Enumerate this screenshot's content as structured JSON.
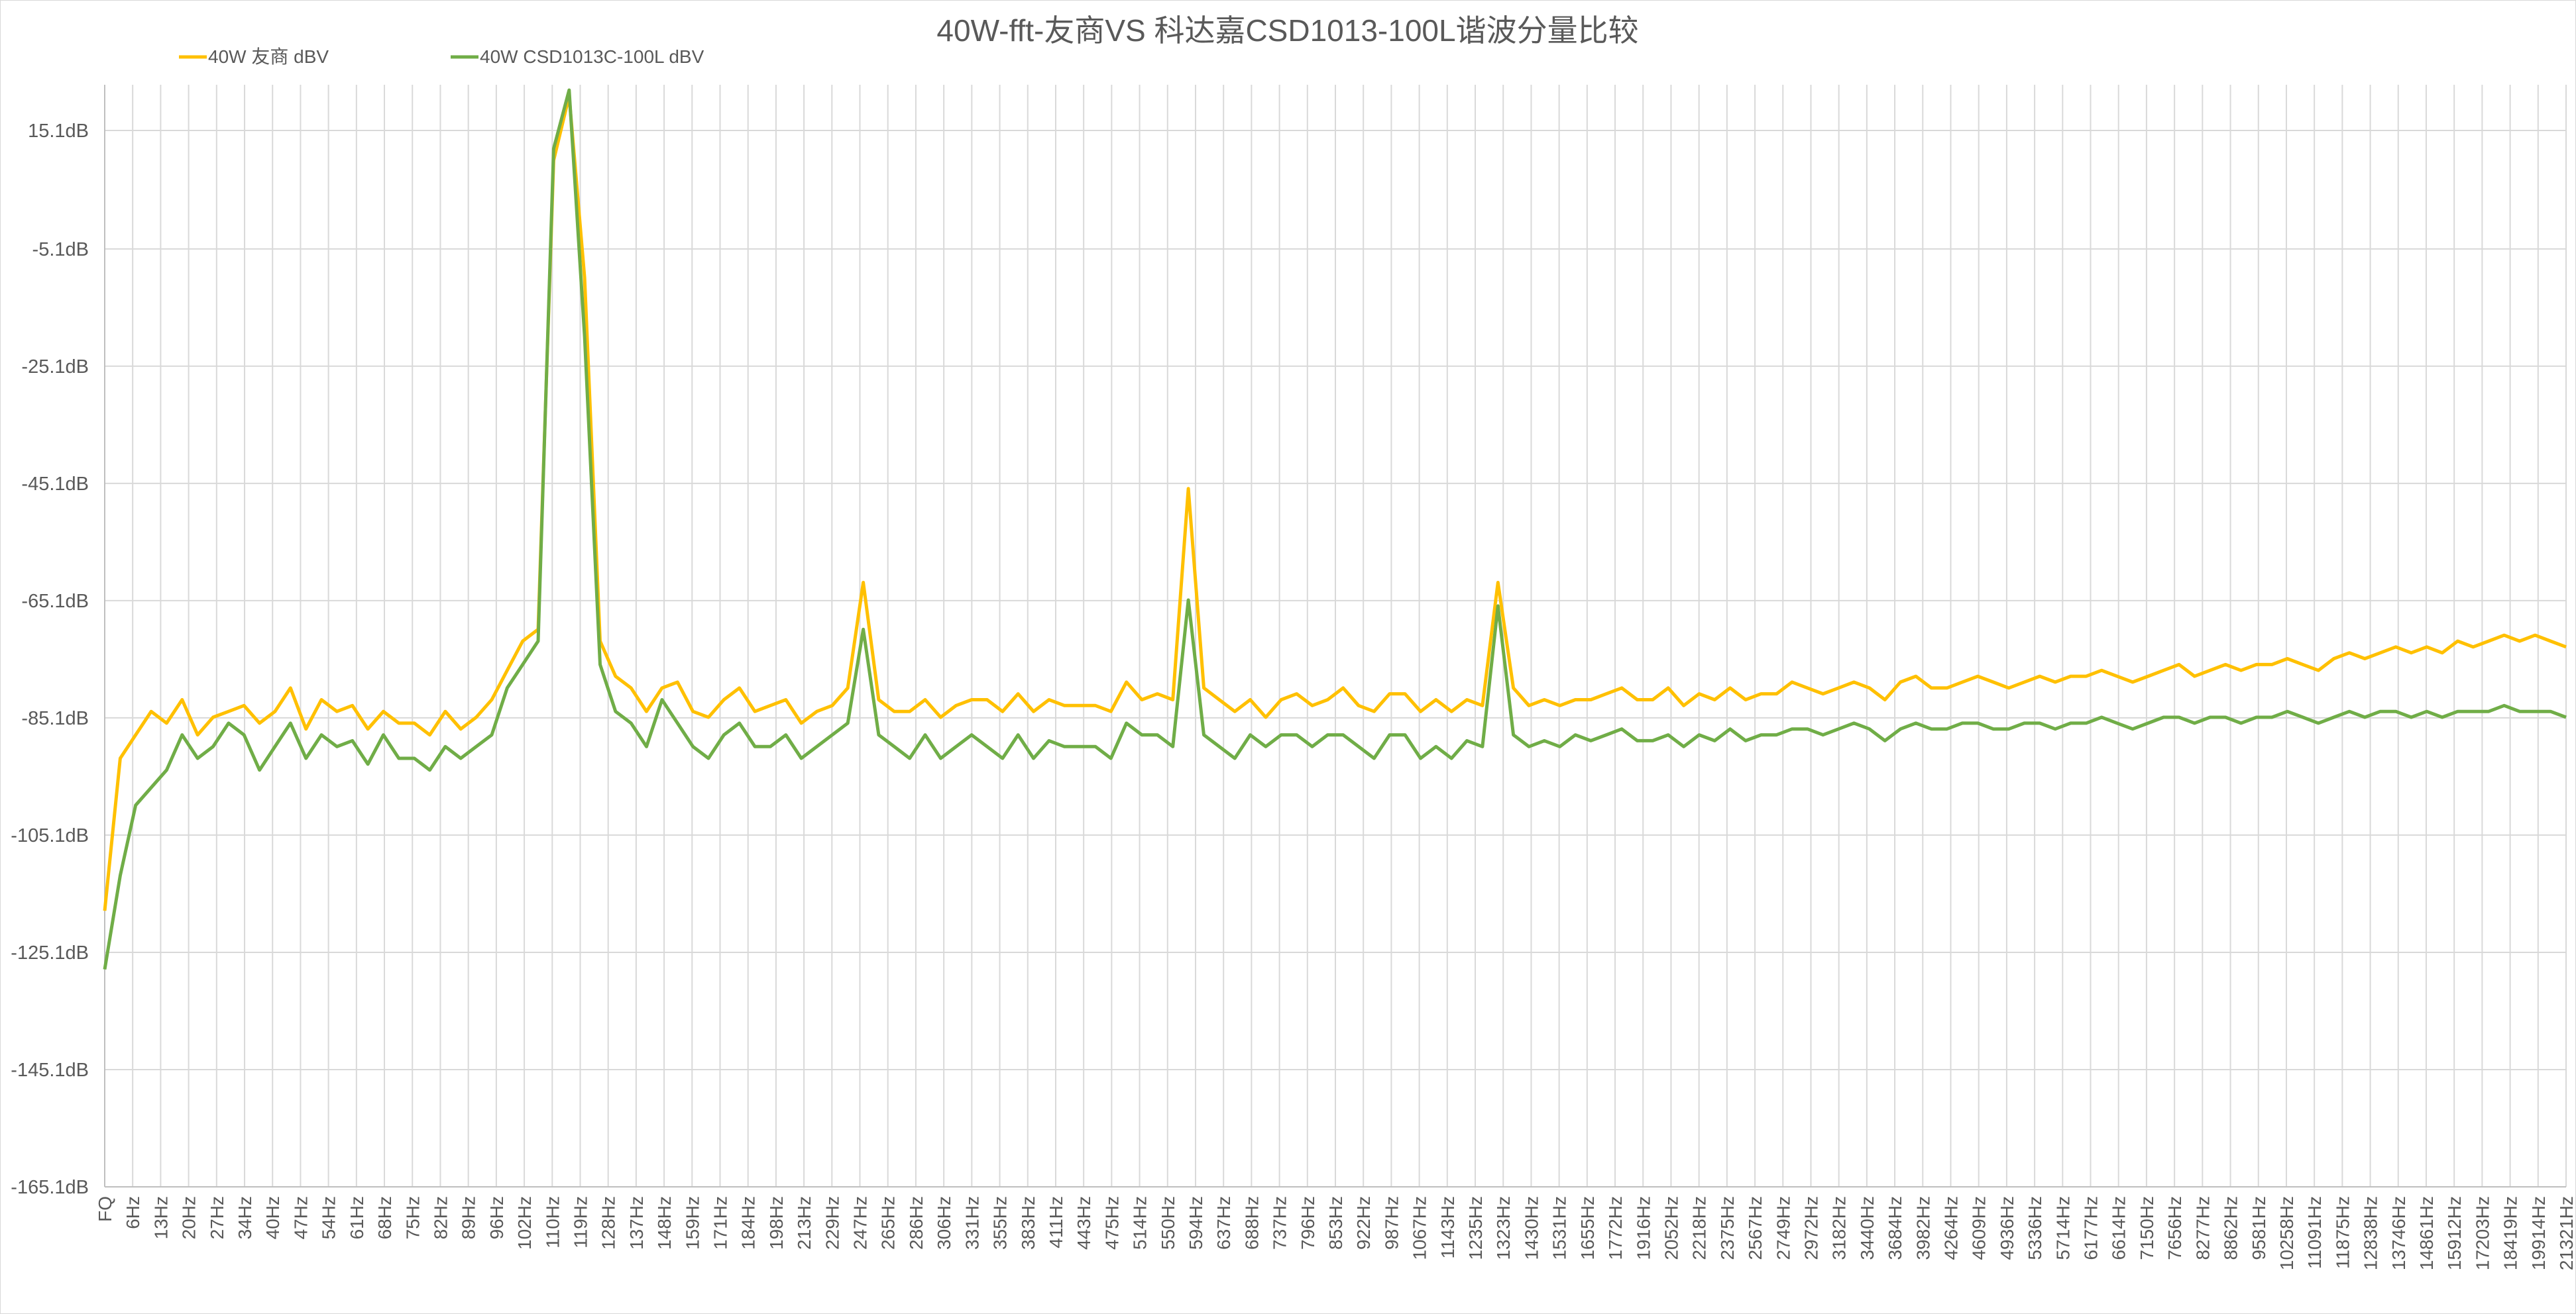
{
  "chart_data": {
    "type": "line",
    "title": "40W-fft-友商VS 科达嘉CSD1013-100L谐波分量比较",
    "xlabel": "",
    "ylabel": "",
    "legend_position": "top-left",
    "grid": true,
    "ylim": [
      -165.1,
      22.9
    ],
    "y_ticks": [
      15.1,
      -5.1,
      -25.1,
      -45.1,
      -65.1,
      -85.1,
      -105.1,
      -125.1,
      -145.1,
      -165.1
    ],
    "y_tick_labels": [
      "15.1dB",
      "-5.1dB",
      "-25.1dB",
      "-45.1dB",
      "-65.1dB",
      "-85.1dB",
      "-105.1dB",
      "-125.1dB",
      "-145.1dB",
      "-165.1dB"
    ],
    "x_tick_labels": [
      "FQ",
      "6Hz",
      "13Hz",
      "20Hz",
      "27Hz",
      "34Hz",
      "40Hz",
      "47Hz",
      "54Hz",
      "61Hz",
      "68Hz",
      "75Hz",
      "82Hz",
      "89Hz",
      "96Hz",
      "102Hz",
      "110Hz",
      "119Hz",
      "128Hz",
      "137Hz",
      "148Hz",
      "159Hz",
      "171Hz",
      "184Hz",
      "198Hz",
      "213Hz",
      "229Hz",
      "247Hz",
      "265Hz",
      "286Hz",
      "306Hz",
      "331Hz",
      "355Hz",
      "383Hz",
      "411Hz",
      "443Hz",
      "475Hz",
      "514Hz",
      "550Hz",
      "594Hz",
      "637Hz",
      "688Hz",
      "737Hz",
      "796Hz",
      "853Hz",
      "922Hz",
      "987Hz",
      "1067Hz",
      "1143Hz",
      "1235Hz",
      "1323Hz",
      "1430Hz",
      "1531Hz",
      "1655Hz",
      "1772Hz",
      "1916Hz",
      "2052Hz",
      "2218Hz",
      "2375Hz",
      "2567Hz",
      "2749Hz",
      "2972Hz",
      "3182Hz",
      "3440Hz",
      "3684Hz",
      "3982Hz",
      "4264Hz",
      "4609Hz",
      "4936Hz",
      "5336Hz",
      "5714Hz",
      "6177Hz",
      "6614Hz",
      "7150Hz",
      "7656Hz",
      "8277Hz",
      "8862Hz",
      "9581Hz",
      "10258Hz",
      "11091Hz",
      "11875Hz",
      "12838Hz",
      "13746Hz",
      "14861Hz",
      "15912Hz",
      "17203Hz",
      "18419Hz",
      "19914Hz",
      "21321Hz"
    ],
    "series": [
      {
        "name": "40W 友商 dBV",
        "color": "#FFC000",
        "values": [
          -118,
          -92,
          -88,
          -84,
          -86,
          -82,
          -88,
          -85,
          -84,
          -83,
          -86,
          -84,
          -80,
          -87,
          -82,
          -84,
          -83,
          -87,
          -84,
          -86,
          -86,
          -88,
          -84,
          -87,
          -85,
          -82,
          -77,
          -72,
          -70,
          10,
          21,
          -10,
          -72,
          -78,
          -80,
          -84,
          -80,
          -79,
          -84,
          -85,
          -82,
          -80,
          -84,
          -83,
          -82,
          -86,
          -84,
          -83,
          -80,
          -62,
          -82,
          -84,
          -84,
          -82,
          -85,
          -83,
          -82,
          -82,
          -84,
          -81,
          -84,
          -82,
          -83,
          -83,
          -83,
          -84,
          -79,
          -82,
          -81,
          -82,
          -46,
          -80,
          -82,
          -84,
          -82,
          -85,
          -82,
          -81,
          -83,
          -82,
          -80,
          -83,
          -84,
          -81,
          -81,
          -84,
          -82,
          -84,
          -82,
          -83,
          -62,
          -80,
          -83,
          -82,
          -83,
          -82,
          -82,
          -81,
          -80,
          -82,
          -82,
          -80,
          -83,
          -81,
          -82,
          -80,
          -82,
          -81,
          -81,
          -79,
          -80,
          -81,
          -80,
          -79,
          -80,
          -82,
          -79,
          -78,
          -80,
          -80,
          -79,
          -78,
          -79,
          -80,
          -79,
          -78,
          -79,
          -78,
          -78,
          -77,
          -78,
          -79,
          -78,
          -77,
          -76,
          -78,
          -77,
          -76,
          -77,
          -76,
          -76,
          -75,
          -76,
          -77,
          -75,
          -74,
          -75,
          -74,
          -73,
          -74,
          -73,
          -74,
          -72,
          -73,
          -72,
          -71,
          -72,
          -71,
          -72,
          -73
        ]
      },
      {
        "name": "40W CSD1013C-100L dBV",
        "color": "#70AD47",
        "values": [
          -128,
          -112,
          -100,
          -97,
          -94,
          -88,
          -92,
          -90,
          -86,
          -88,
          -94,
          -90,
          -86,
          -92,
          -88,
          -90,
          -89,
          -93,
          -88,
          -92,
          -92,
          -94,
          -90,
          -92,
          -90,
          -88,
          -80,
          -76,
          -72,
          12,
          22,
          -20,
          -76,
          -84,
          -86,
          -90,
          -82,
          -86,
          -90,
          -92,
          -88,
          -86,
          -90,
          -90,
          -88,
          -92,
          -90,
          -88,
          -86,
          -70,
          -88,
          -90,
          -92,
          -88,
          -92,
          -90,
          -88,
          -90,
          -92,
          -88,
          -92,
          -89,
          -90,
          -90,
          -90,
          -92,
          -86,
          -88,
          -88,
          -90,
          -65,
          -88,
          -90,
          -92,
          -88,
          -90,
          -88,
          -88,
          -90,
          -88,
          -88,
          -90,
          -92,
          -88,
          -88,
          -92,
          -90,
          -92,
          -89,
          -90,
          -66,
          -88,
          -90,
          -89,
          -90,
          -88,
          -89,
          -88,
          -87,
          -89,
          -89,
          -88,
          -90,
          -88,
          -89,
          -87,
          -89,
          -88,
          -88,
          -87,
          -87,
          -88,
          -87,
          -86,
          -87,
          -89,
          -87,
          -86,
          -87,
          -87,
          -86,
          -86,
          -87,
          -87,
          -86,
          -86,
          -87,
          -86,
          -86,
          -85,
          -86,
          -87,
          -86,
          -85,
          -85,
          -86,
          -85,
          -85,
          -86,
          -85,
          -85,
          -84,
          -85,
          -86,
          -85,
          -84,
          -85,
          -84,
          -84,
          -85,
          -84,
          -85,
          -84,
          -84,
          -84,
          -83,
          -84,
          -84,
          -84,
          -85
        ]
      }
    ]
  }
}
